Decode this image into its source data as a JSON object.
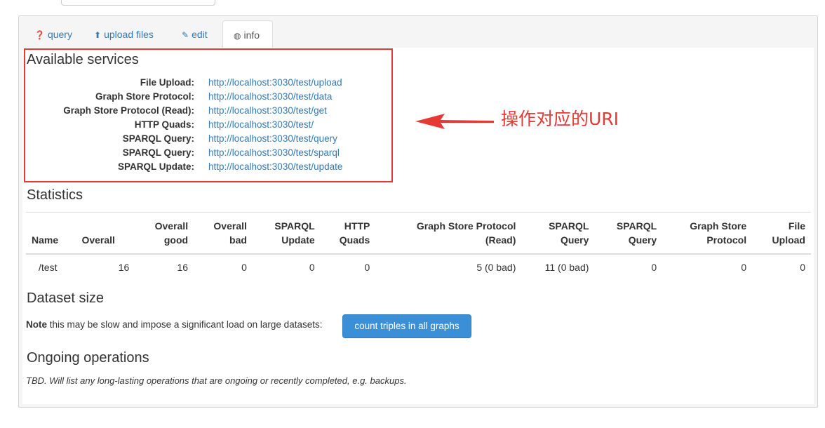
{
  "tabs": [
    {
      "label": "query",
      "icon": "question-circle-icon"
    },
    {
      "label": "upload files",
      "icon": "upload-icon"
    },
    {
      "label": "edit",
      "icon": "edit-icon"
    },
    {
      "label": "info",
      "icon": "dashboard-icon"
    }
  ],
  "services": {
    "title": "Available services",
    "items": [
      {
        "label": "File Upload:",
        "url": "http://localhost:3030/test/upload"
      },
      {
        "label": "Graph Store Protocol:",
        "url": "http://localhost:3030/test/data"
      },
      {
        "label": "Graph Store Protocol (Read):",
        "url": "http://localhost:3030/test/get"
      },
      {
        "label": "HTTP Quads:",
        "url": "http://localhost:3030/test/"
      },
      {
        "label": "SPARQL Query:",
        "url": "http://localhost:3030/test/query"
      },
      {
        "label": "SPARQL Query:",
        "url": "http://localhost:3030/test/sparql"
      },
      {
        "label": "SPARQL Update:",
        "url": "http://localhost:3030/test/update"
      }
    ]
  },
  "annotation": {
    "text": "操作对应的URI",
    "color": "#e53935"
  },
  "statistics": {
    "title": "Statistics",
    "headers": [
      [
        "Name"
      ],
      [
        "Overall"
      ],
      [
        "Overall",
        "good"
      ],
      [
        "Overall",
        "bad"
      ],
      [
        "SPARQL",
        "Update"
      ],
      [
        "HTTP",
        "Quads"
      ],
      [
        "Graph Store Protocol",
        "(Read)"
      ],
      [
        "SPARQL",
        "Query"
      ],
      [
        "SPARQL",
        "Query"
      ],
      [
        "Graph Store",
        "Protocol"
      ],
      [
        "File",
        "Upload"
      ]
    ],
    "row": [
      "/test",
      "16",
      "16",
      "0",
      "0",
      "0",
      "5 (0 bad)",
      "11 (0 bad)",
      "0",
      "0",
      "0"
    ]
  },
  "dataset_size": {
    "title": "Dataset size",
    "note_bold": "Note",
    "note_text": " this may be slow and impose a significant load on large datasets:",
    "button_label": "count triples in all graphs"
  },
  "ongoing": {
    "title": "Ongoing operations",
    "text": "TBD. Will list any long-lasting operations that are ongoing or recently completed, e.g. backups."
  },
  "colors": {
    "link": "#337ab7",
    "button": "#3a8fd6",
    "highlight": "#e53935"
  }
}
